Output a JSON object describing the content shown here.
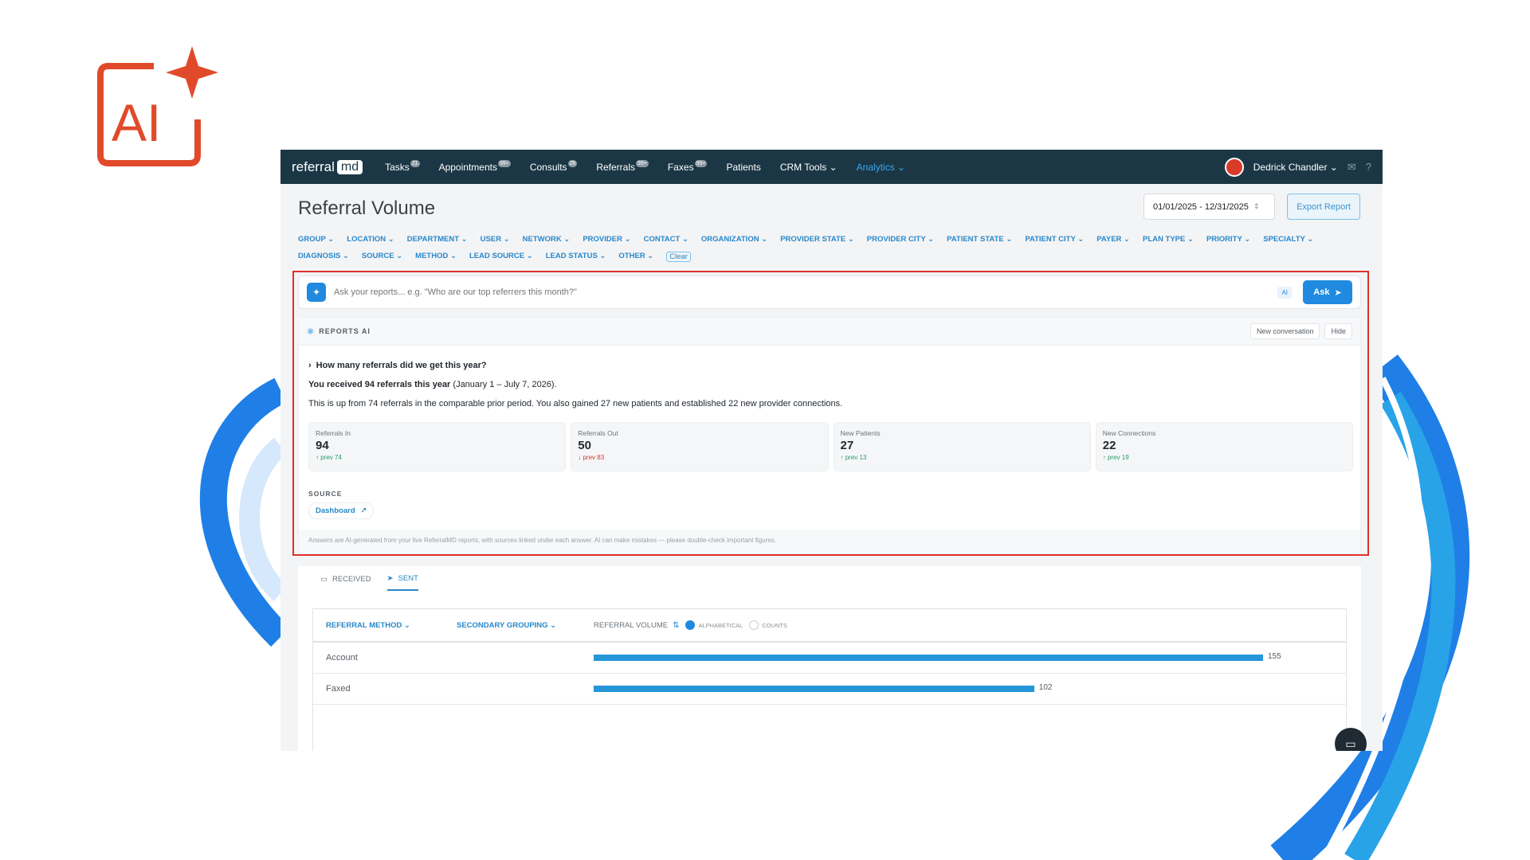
{
  "nav": {
    "brand_text": "referral",
    "brand_md": "md",
    "items": [
      {
        "label": "Tasks",
        "badge": "21"
      },
      {
        "label": "Appointments",
        "badge": "99+"
      },
      {
        "label": "Consults",
        "badge": "26"
      },
      {
        "label": "Referrals",
        "badge": "99+"
      },
      {
        "label": "Faxes",
        "badge": "99+"
      },
      {
        "label": "Patients",
        "badge": ""
      },
      {
        "label": "CRM Tools ⌄",
        "badge": ""
      },
      {
        "label": "Analytics ⌄",
        "badge": ""
      }
    ],
    "user_name": "Dedrick Chandler ⌄"
  },
  "page": {
    "title": "Referral Volume",
    "date_range": "01/01/2025 - 12/31/2025",
    "export_label": "Export Report"
  },
  "filters": [
    "GROUP ⌄",
    "LOCATION ⌄",
    "DEPARTMENT ⌄",
    "USER ⌄",
    "NETWORK ⌄",
    "PROVIDER ⌄",
    "CONTACT ⌄",
    "ORGANIZATION ⌄",
    "PROVIDER STATE ⌄",
    "PROVIDER CITY ⌄",
    "PATIENT STATE ⌄",
    "PATIENT CITY ⌄",
    "PAYER ⌄",
    "PLAN TYPE ⌄",
    "PRIORITY ⌄",
    "SPECIALTY ⌄",
    "DIAGNOSIS ⌄",
    "SOURCE ⌄",
    "METHOD ⌄",
    "LEAD SOURCE ⌄",
    "LEAD STATUS ⌄",
    "OTHER ⌄"
  ],
  "filter_clear": "Clear",
  "ask": {
    "placeholder": "Ask your reports... e.g. \"Who are our top referrers this month?\"",
    "ai_tag": "AI",
    "button": "Ask"
  },
  "ai_panel": {
    "label": "REPORTS AI",
    "new_conversation": "New conversation",
    "hide": "Hide",
    "question": "How many referrals did we get this year?",
    "answer_bold": "You received 94 referrals this year",
    "answer_rest": " (January 1 – July 7, 2026).",
    "answer_detail": "This is up from 74 referrals in the comparable prior period. You also gained 27 new patients and established 22 new provider connections.",
    "stats": [
      {
        "label": "Referrals In",
        "value": "94",
        "prev": "↑ prev 74",
        "trend": "up"
      },
      {
        "label": "Referrals Out",
        "value": "50",
        "prev": "↓ prev 83",
        "trend": "down"
      },
      {
        "label": "New Patients",
        "value": "27",
        "prev": "↑ prev 13",
        "trend": "up"
      },
      {
        "label": "New Connections",
        "value": "22",
        "prev": "↑ prev 19",
        "trend": "up"
      }
    ],
    "source_label": "SOURCE",
    "source_link": "Dashboard",
    "disclaimer": "Answers are AI-generated from your live ReferralMD reports, with sources linked under each answer. AI can make mistakes — please double-check important figures."
  },
  "tabs": [
    {
      "label": "RECEIVED",
      "active": false
    },
    {
      "label": "SENT",
      "active": true
    }
  ],
  "report": {
    "col1": "REFERRAL METHOD ⌄",
    "col2": "SECONDARY GROUPING ⌄",
    "col3": "REFERRAL VOLUME",
    "sort_alpha": "ALPHABETICAL",
    "sort_counts": "COUNTS",
    "max": 155,
    "rows": [
      {
        "name": "Account",
        "value": 155
      },
      {
        "name": "Faxed",
        "value": 102
      }
    ]
  },
  "colors": {
    "nav_bg": "#1b3746",
    "accent": "#1f8ae0",
    "highlight": "#e0302a",
    "brand_ai": "#e04a2a"
  }
}
